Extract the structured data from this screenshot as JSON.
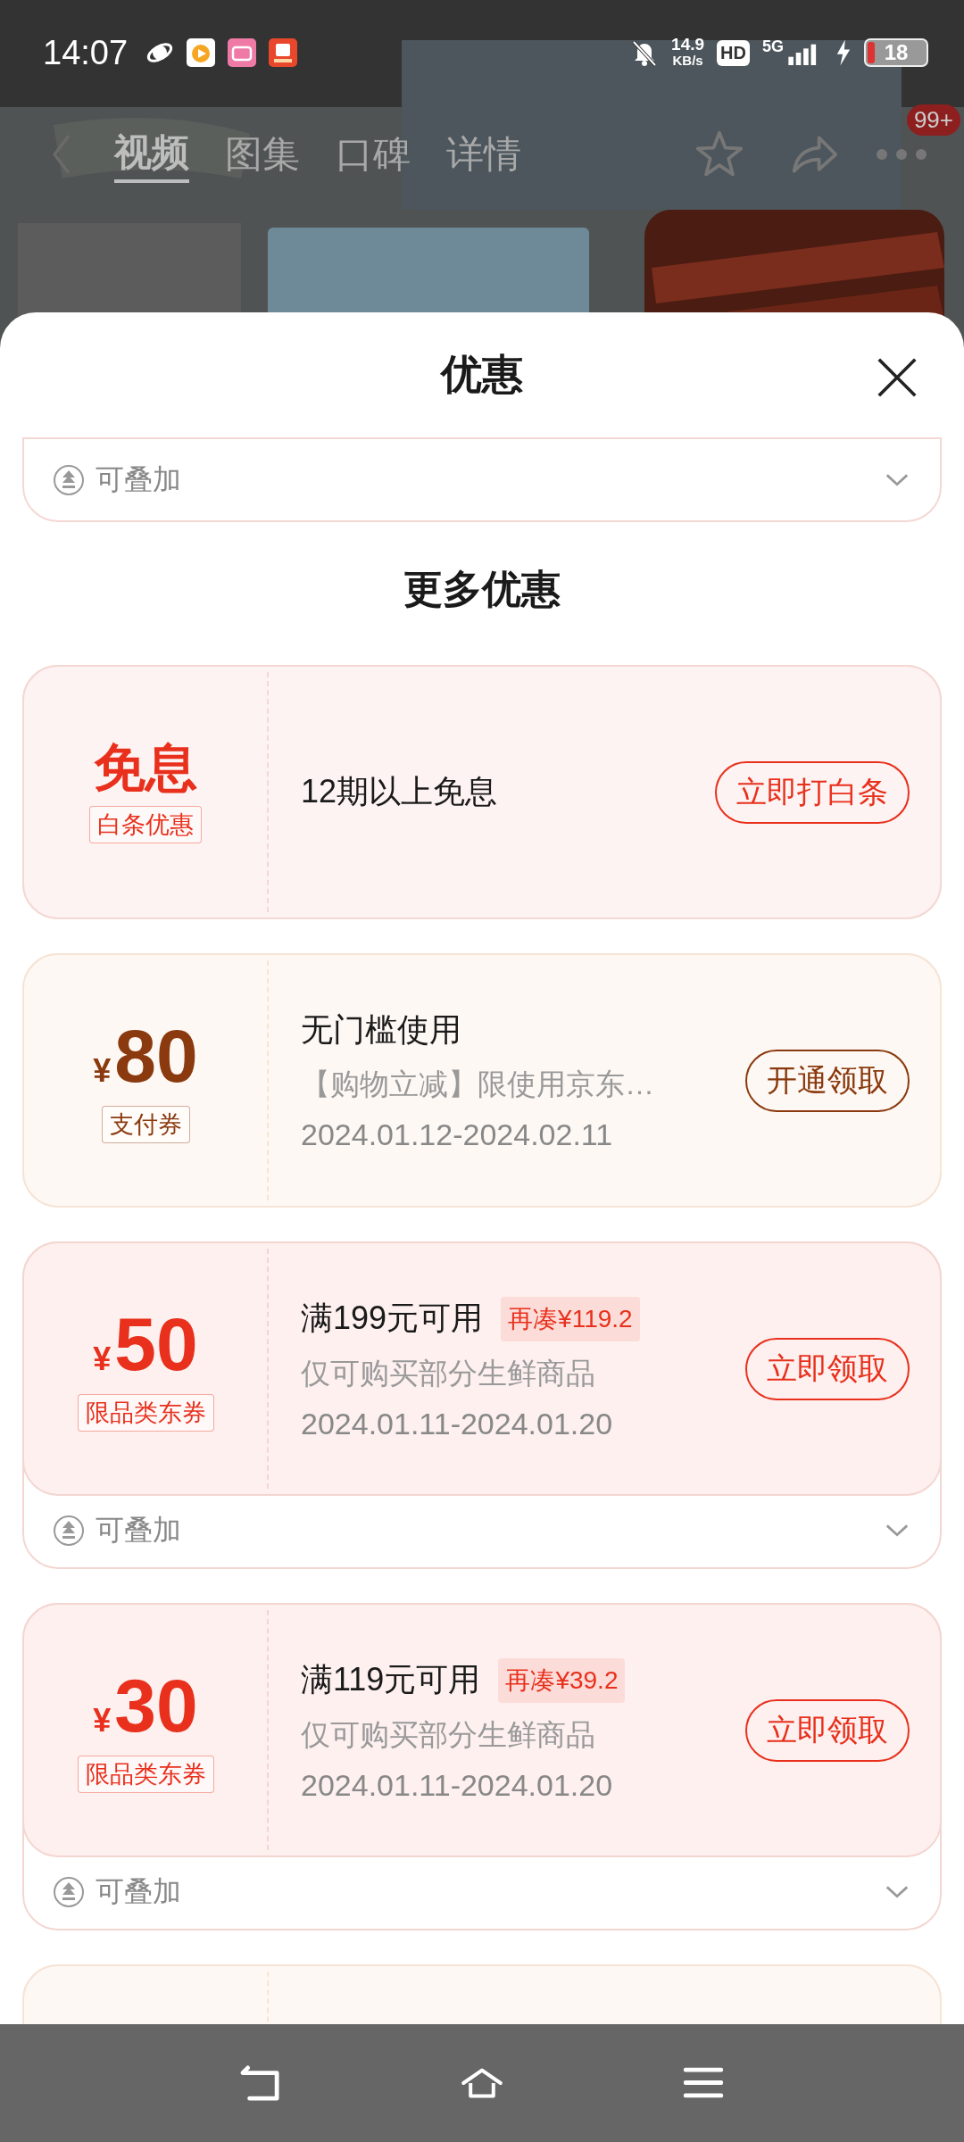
{
  "status_bar": {
    "time": "14:07",
    "net_speed": "14.9",
    "net_unit": "KB/s",
    "hd": "HD",
    "network": "5G",
    "battery": "18"
  },
  "nav": {
    "tabs": [
      {
        "label": "视频",
        "selected": true
      },
      {
        "label": "图集",
        "selected": false
      },
      {
        "label": "口碑",
        "selected": false
      },
      {
        "label": "详情",
        "selected": false
      }
    ],
    "badge": "99+"
  },
  "sheet": {
    "title": "优惠",
    "top_card": {
      "stack_label": "可叠加"
    },
    "section_title": "更多优惠",
    "offers": [
      {
        "kind": "baitiao",
        "amount": "免息",
        "tag": "白条优惠",
        "title": "12期以上免息",
        "button": "立即打白条"
      },
      {
        "kind": "pay_coupon",
        "currency": "¥",
        "amount": "80",
        "tag": "支付券",
        "title": "无门槛使用",
        "desc": "【购物立减】限使用京东…",
        "dates": "2024.01.12-2024.02.11",
        "button": "开通领取"
      },
      {
        "kind": "category_coupon",
        "currency": "¥",
        "amount": "50",
        "tag": "限品类东券",
        "title": "满199元可用",
        "hint": "再凑¥119.2",
        "desc": "仅可购买部分生鲜商品",
        "dates": "2024.01.11-2024.01.20",
        "button": "立即领取",
        "stack_label": "可叠加"
      },
      {
        "kind": "category_coupon",
        "currency": "¥",
        "amount": "30",
        "tag": "限品类东券",
        "title": "满119元可用",
        "hint": "再凑¥39.2",
        "desc": "仅可购买部分生鲜商品",
        "dates": "2024.01.11-2024.01.20",
        "button": "立即领取",
        "stack_label": "可叠加"
      },
      {
        "kind": "pay_coupon"
      }
    ]
  }
}
